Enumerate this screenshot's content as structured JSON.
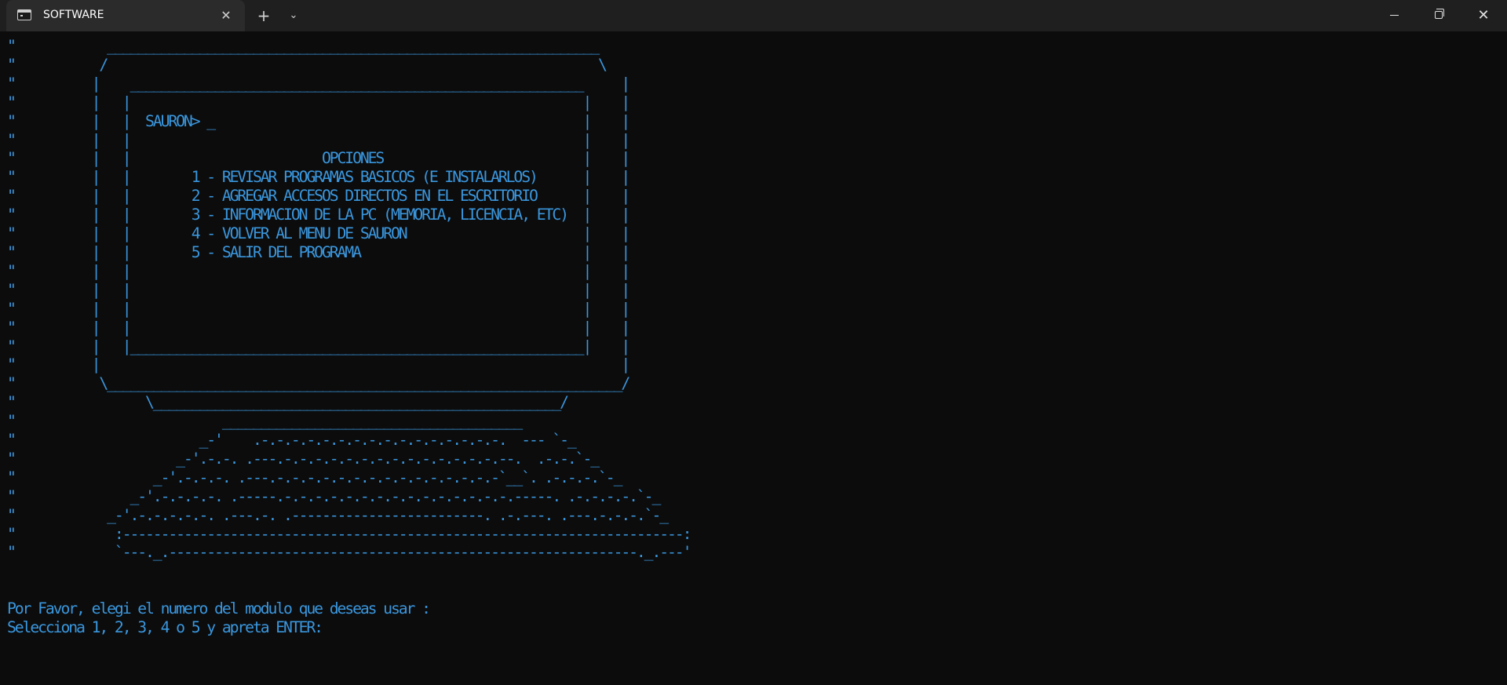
{
  "window": {
    "tab_title": "SOFTWARE",
    "tab_icon": "terminal-icon",
    "close_tab_icon": "close-icon",
    "new_tab_icon": "plus-icon",
    "dropdown_icon": "chevron-down-icon",
    "tab_close_glyph": "✕",
    "new_tab_glyph": "+",
    "dropdown_glyph": "⌄",
    "close_glyph": "✕"
  },
  "terminal": {
    "text_color": "#3a96dd",
    "background": "#0c0c0c",
    "screen": "\"            ________________________________________________________________\n\"           /                                                                \\\n\"          |    ___________________________________________________________     |\n\"          |   |                                                           |    |\n\"          |   |  SAURON> _                                                |    |\n\"          |   |                                                           |    |\n\"          |   |                         OPCIONES                          |    |\n\"          |   |        1 - REVISAR PROGRAMAS BASICOS (E INSTALARLOS)      |    |\n\"          |   |        2 - AGREGAR ACCESOS DIRECTOS EN EL ESCRITORIO      |    |\n\"          |   |        3 - INFORMACION DE LA PC (MEMORIA, LICENCIA, ETC)  |    |\n\"          |   |        4 - VOLVER AL MENU DE SAURON                       |    |\n\"          |   |        5 - SALIR DEL PROGRAMA                             |    |\n\"          |   |                                                           |    |\n\"          |   |                                                           |    |\n\"          |   |                                                           |    |\n\"          |   |                                                           |    |\n\"          |   |___________________________________________________________|    |\n\"          |                                                                    |\n\"           \\___________________________________________________________________/\n\"                 \\_____________________________________________________/\n\"                           _______________________________________\n\"                        _-'    .-.-.-.-.-.-.-.-.-.-.-.-.-.-.-.-.  --- `-_\n\"                     _-'.-.-. .---.-.-.-.-.-.-.-.-.-.-.-.-.-.-.--.  .-.-.`-_\n\"                  _-'.-.-.-. .---.-.-.-.-.-.-.-.-.-.-.-.-.-.-.-`__`. .-.-.-.`-_\n\"               _-'.-.-.-.-. .-----.-.-.-.-.-.-.-.-.-.-.-.-.-.-.-.-----. .-.-.-.-.`-_\n\"            _-'.-.-.-.-.-. .---.-. .-------------------------. .-.---. .---.-.-.-.`-_\n\"             :-------------------------------------------------------------------------:\n\"             `---._.-------------------------------------------------------------._.---'\n\n\nPor Favor, elegi el numero del modulo que deseas usar :\nSelecciona 1, 2, 3, 4 o 5 y apreta ENTER:"
  }
}
